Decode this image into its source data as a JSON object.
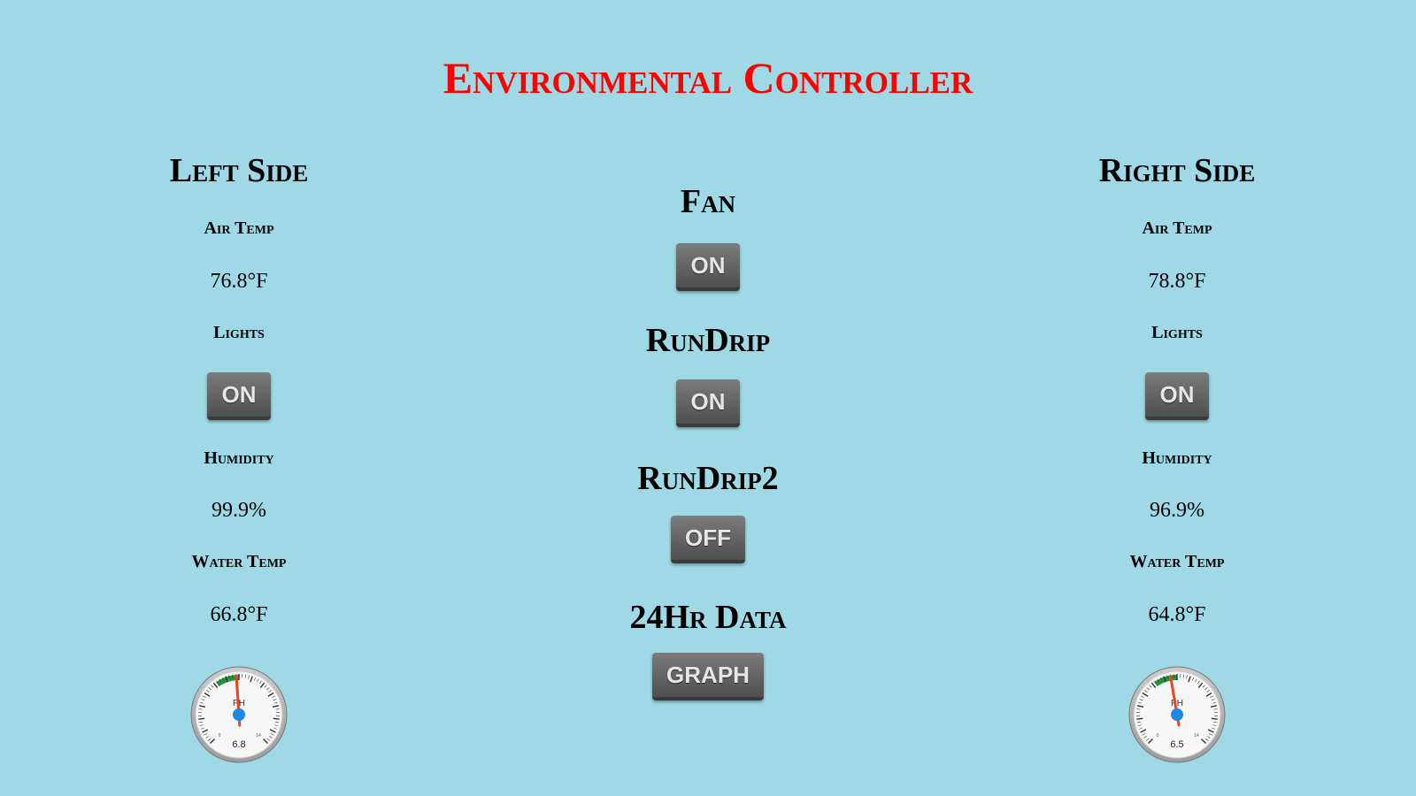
{
  "title": "Environmental Controller",
  "left": {
    "heading": "Left Side",
    "air_temp_label": "Air Temp",
    "air_temp_value": "76.8°F",
    "lights_label": "Lights",
    "lights_button": "ON",
    "humidity_label": "Humidity",
    "humidity_value": "99.9%",
    "water_temp_label": "Water Temp",
    "water_temp_value": "66.8°F",
    "gauge": {
      "label": "PH",
      "value": 6.8,
      "value_text": "6.8",
      "min_text": "0",
      "max_text": "14",
      "min": 0,
      "max": 14
    }
  },
  "center": {
    "fan_label": "Fan",
    "fan_button": "ON",
    "rundrip_label": "RunDrip",
    "rundrip_button": "ON",
    "rundrip2_label": "RunDrip2",
    "rundrip2_button": "OFF",
    "data_label": "24Hr Data",
    "graph_button": "GRAPH"
  },
  "right": {
    "heading": "Right Side",
    "air_temp_label": "Air Temp",
    "air_temp_value": "78.8°F",
    "lights_label": "Lights",
    "lights_button": "ON",
    "humidity_label": "Humidity",
    "humidity_value": "96.9%",
    "water_temp_label": "Water Temp",
    "water_temp_value": "64.8°F",
    "gauge": {
      "label": "PH",
      "value": 6.5,
      "value_text": "6.5",
      "min_text": "0",
      "max_text": "14",
      "min": 0,
      "max": 14
    }
  },
  "colors": {
    "background": "#9fd9e6",
    "title": "#ff0000",
    "button": "#5e5e5e",
    "gauge_needle": "#e8461e",
    "gauge_hub": "#1e88e5",
    "gauge_band": "#1f9a3a"
  }
}
